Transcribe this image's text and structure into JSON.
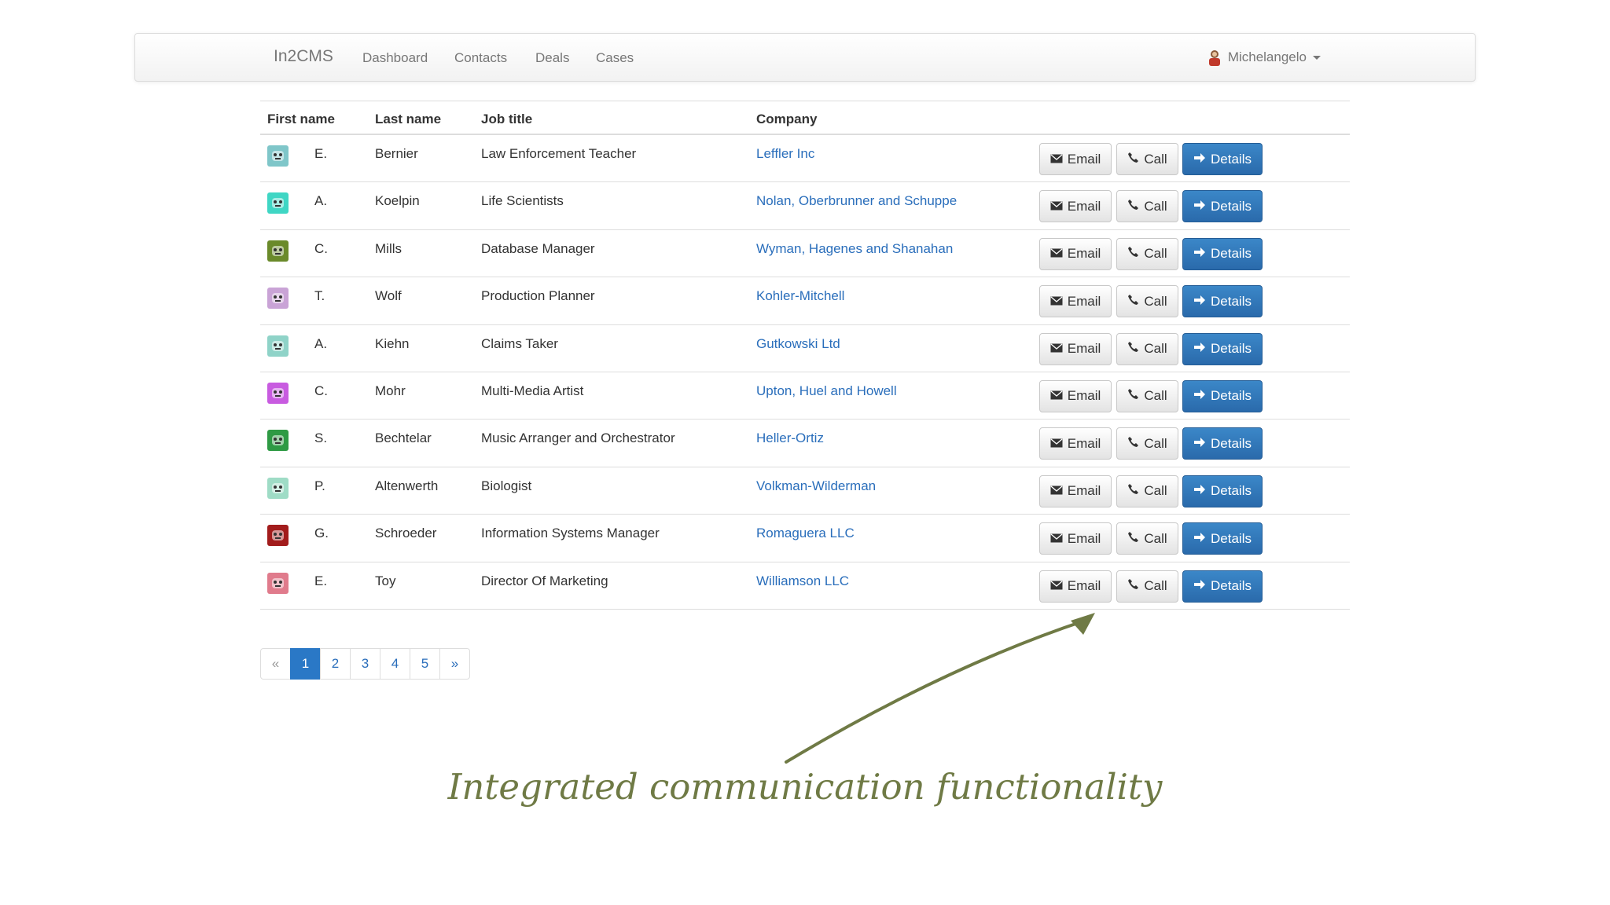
{
  "navbar": {
    "brand": "In2CMS",
    "links": [
      "Dashboard",
      "Contacts",
      "Deals",
      "Cases"
    ],
    "user": "Michelangelo"
  },
  "table": {
    "headers": {
      "first_name": "First name",
      "last_name": "Last name",
      "job_title": "Job title",
      "company": "Company"
    },
    "buttons": {
      "email": "Email",
      "call": "Call",
      "details": "Details"
    },
    "rows": [
      {
        "initial": "E.",
        "last": "Bernier",
        "job": "Law Enforcement Teacher",
        "company": "Leffler Inc",
        "avatar_color": "#7fc6c9"
      },
      {
        "initial": "A.",
        "last": "Koelpin",
        "job": "Life Scientists",
        "company": "Nolan, Oberbrunner and Schuppe",
        "avatar_color": "#3fd6c4"
      },
      {
        "initial": "C.",
        "last": "Mills",
        "job": "Database Manager",
        "company": "Wyman, Hagenes and Shanahan",
        "avatar_color": "#6a8a2a"
      },
      {
        "initial": "T.",
        "last": "Wolf",
        "job": "Production Planner",
        "company": "Kohler-Mitchell",
        "avatar_color": "#c9a3d6"
      },
      {
        "initial": "A.",
        "last": "Kiehn",
        "job": "Claims Taker",
        "company": "Gutkowski Ltd",
        "avatar_color": "#8fd3c8"
      },
      {
        "initial": "C.",
        "last": "Mohr",
        "job": "Multi-Media Artist",
        "company": "Upton, Huel and Howell",
        "avatar_color": "#c85be0"
      },
      {
        "initial": "S.",
        "last": "Bechtelar",
        "job": "Music Arranger and Orchestrator",
        "company": "Heller-Ortiz",
        "avatar_color": "#2e9a44"
      },
      {
        "initial": "P.",
        "last": "Altenwerth",
        "job": "Biologist",
        "company": "Volkman-Wilderman",
        "avatar_color": "#9fdcc6"
      },
      {
        "initial": "G.",
        "last": "Schroeder",
        "job": "Information Systems Manager",
        "company": "Romaguera LLC",
        "avatar_color": "#a21c1c"
      },
      {
        "initial": "E.",
        "last": "Toy",
        "job": "Director Of Marketing",
        "company": "Williamson LLC",
        "avatar_color": "#e07b8c"
      }
    ]
  },
  "pagination": {
    "prev": "«",
    "pages": [
      "1",
      "2",
      "3",
      "4",
      "5"
    ],
    "next": "»",
    "active": "1"
  },
  "caption": "Integrated communication functionality",
  "colors": {
    "primary": "#2a6aab",
    "link": "#2a6ebb",
    "caption": "#6f7a45"
  }
}
